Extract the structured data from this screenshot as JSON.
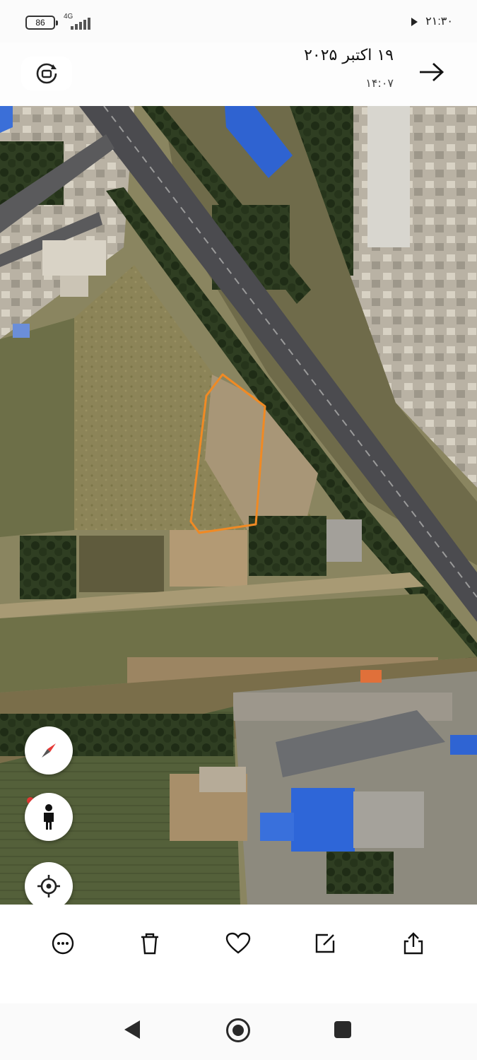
{
  "status_bar": {
    "battery": "86",
    "network": "4G",
    "time": "۲۱:۳۰"
  },
  "header": {
    "date": "۱۹ اکتبر ۲۰۲۵",
    "time": "۱۴:۰۷"
  },
  "map": {
    "view": "satellite",
    "boundary_color": "#f08a24"
  },
  "map_controls": {
    "compass_icon": "compass-icon",
    "person_icon": "street-view-person-icon",
    "locate_icon": "my-location-icon"
  },
  "toolbar": {
    "items": [
      "more-icon",
      "delete-icon",
      "favorite-icon",
      "edit-icon",
      "share-icon"
    ]
  },
  "navigation_bar": {
    "items": [
      "back",
      "home",
      "recents"
    ]
  }
}
